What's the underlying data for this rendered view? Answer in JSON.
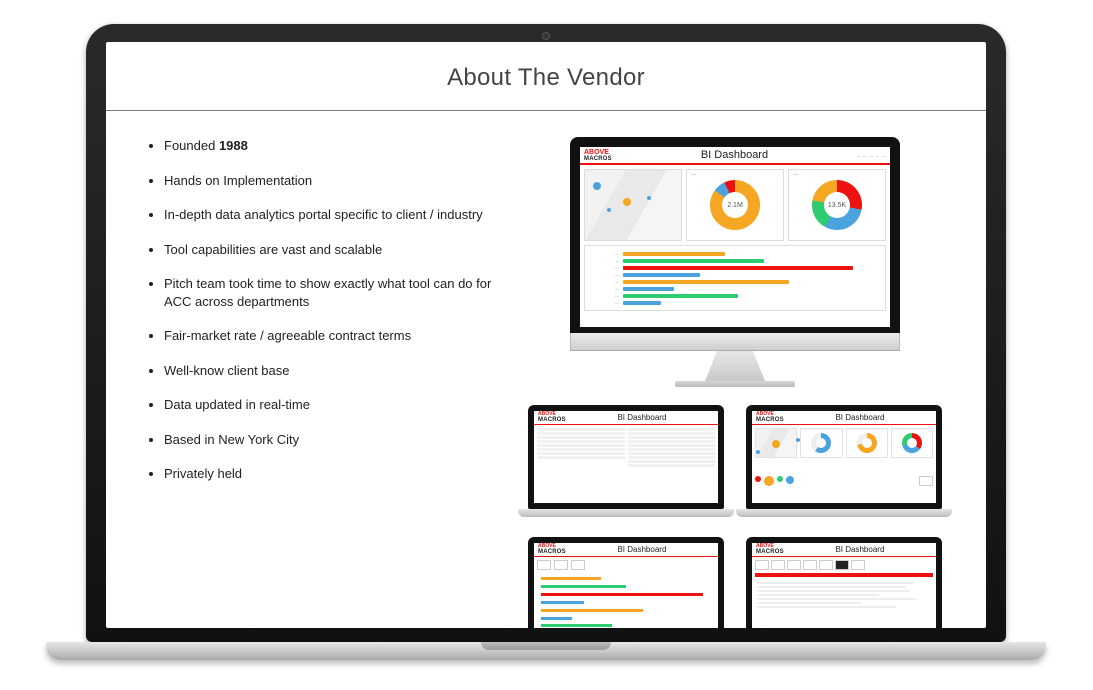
{
  "slide": {
    "title": "About The Vendor"
  },
  "bullets": {
    "b0_prefix": "Founded ",
    "b0_bold": "1988",
    "b1": "Hands on Implementation",
    "b2": "In-depth data analytics portal specific to client / industry",
    "b3": "Tool capabilities are vast and scalable",
    "b4": "Pitch team took time to show exactly what tool can do for ACC across departments",
    "b5": "Fair-market rate / agreeable contract terms",
    "b6": "Well-know client base",
    "b7": "Data updated in real-time",
    "b8": "Based in New York City",
    "b9": "Privately held"
  },
  "vendor_logo": {
    "line1": "ABOVE",
    "line2": "MACROS"
  },
  "dashboard": {
    "title": "BI Dashboard",
    "donut1_label": "2.1M",
    "donut2_label": "13.5K"
  },
  "thumbs": {
    "t1_title": "BI Dashboard",
    "t2_title": "BI Dashboard",
    "t3_title": "BI Dashboard",
    "t4_title": "BI Dashboard"
  }
}
